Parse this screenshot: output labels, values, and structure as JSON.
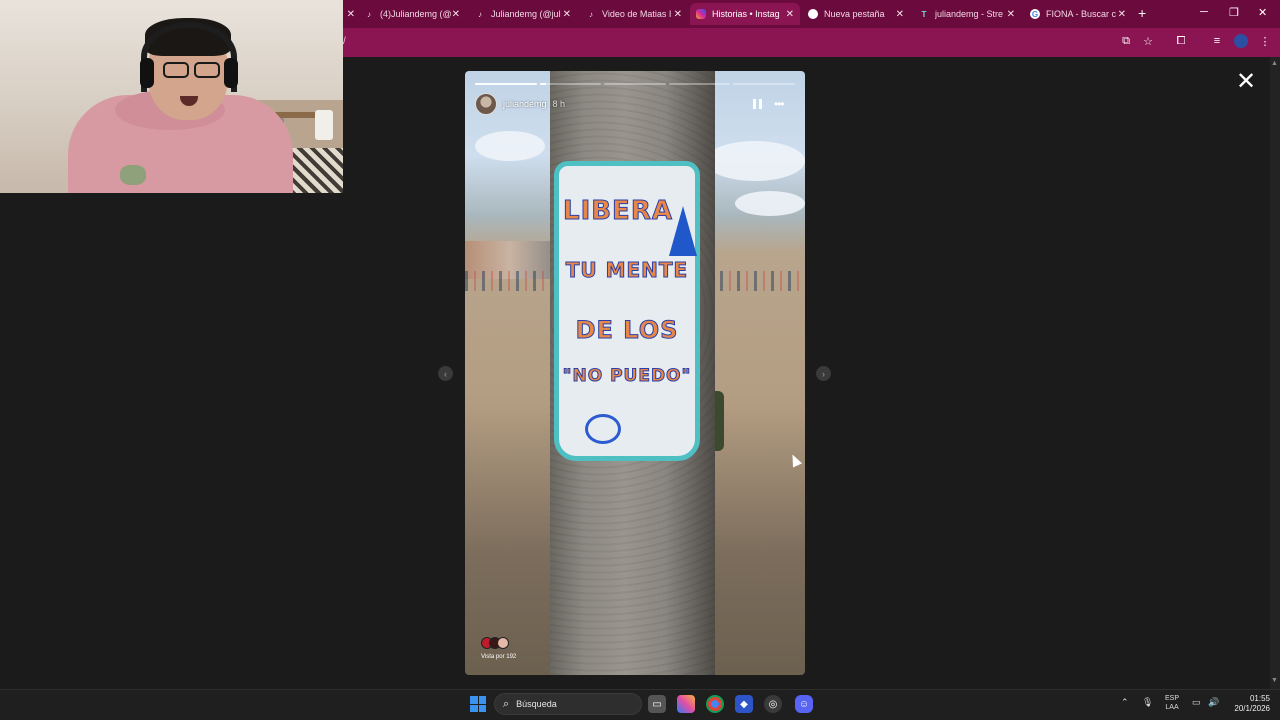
{
  "browser": {
    "tabs": [
      {
        "title": "(4)Juliandemg (@",
        "icon": "tiktok-icon"
      },
      {
        "title": "Juliandemg (@jul",
        "icon": "tiktok-icon"
      },
      {
        "title": "Video de Matias I",
        "icon": "tiktok-icon"
      },
      {
        "title": "Historias • Instag",
        "icon": "instagram-icon",
        "active": true
      },
      {
        "title": "Nueva pestaña",
        "icon": "chrome-icon"
      },
      {
        "title": "juliandemg - Stre",
        "icon": "streamer-icon"
      },
      {
        "title": "FIONA - Buscar c",
        "icon": "google-icon"
      }
    ],
    "address_fragment": "/"
  },
  "story": {
    "username": "juliandemg",
    "time": "8 h",
    "segments": 5,
    "current_segment": 2,
    "current_progress": 0.1,
    "seen_by": "Vista por 192",
    "sign_lines": [
      "LIBERA",
      "TU MENTE",
      "DE LOS",
      "\"NO PUEDO\""
    ]
  },
  "taskbar": {
    "search_placeholder": "Búsqueda",
    "lang_top": "ESP",
    "lang_bottom": "LAA",
    "time": "01:55",
    "date": "20/1/2026"
  },
  "colors": {
    "tabbar": "#6b0a3c",
    "toolbar": "#8a1552",
    "sign_border": "#4ec0c4",
    "sign_text": "#e8874a",
    "sign_outline": "#2a3fa8"
  }
}
